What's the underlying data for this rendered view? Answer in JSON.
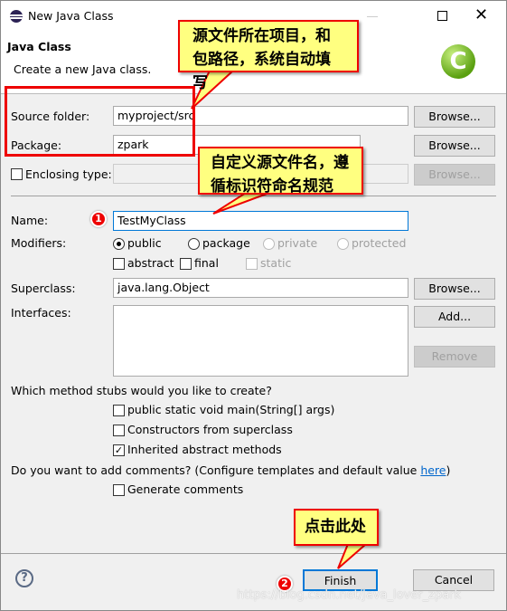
{
  "window": {
    "title": "New Java Class",
    "icon": "eclipse-icon"
  },
  "header": {
    "title": "Java Class",
    "subtitle": "Create a new Java class.",
    "icon": "java-class-c-icon"
  },
  "form": {
    "source_folder": {
      "label": "Source folder:",
      "value": "myproject/src",
      "browse": "Browse..."
    },
    "package": {
      "label": "Package:",
      "value": "zpark",
      "browse": "Browse..."
    },
    "enclosing": {
      "label": "Enclosing type:",
      "value": "",
      "browse": "Browse...",
      "checked": false
    },
    "name": {
      "label": "Name:",
      "value": "TestMyClass"
    },
    "modifiers": {
      "label": "Modifiers:",
      "radios": [
        "public",
        "package",
        "private",
        "protected"
      ],
      "selected": "public",
      "checks": [
        "abstract",
        "final",
        "static"
      ]
    },
    "superclass": {
      "label": "Superclass:",
      "value": "java.lang.Object",
      "browse": "Browse..."
    },
    "interfaces": {
      "label": "Interfaces:",
      "add": "Add...",
      "remove": "Remove"
    },
    "stubs": {
      "question": "Which method stubs would you like to create?",
      "options": [
        {
          "label": "public static void main(String[] args)",
          "checked": false
        },
        {
          "label": "Constructors from superclass",
          "checked": false
        },
        {
          "label": "Inherited abstract methods",
          "checked": true
        }
      ]
    },
    "comments": {
      "question": "Do you want to add comments? (Configure templates and default value ",
      "link": "here",
      "close": ")",
      "option": "Generate comments",
      "checked": false
    }
  },
  "footer": {
    "finish": "Finish",
    "cancel": "Cancel"
  },
  "annotations": {
    "callout1": "源文件所在项目，和包路径，系统自动填写",
    "callout2": "自定义源文件名，遵循标识符命名规范",
    "callout3": "点击此处",
    "badge1": "1",
    "badge2": "2",
    "watermark": "https://blog.csdn.net/Java_lover_zpark"
  },
  "colors": {
    "accent": "#0078d7",
    "callout_bg": "#ffff80",
    "callout_border": "#ee0000"
  }
}
